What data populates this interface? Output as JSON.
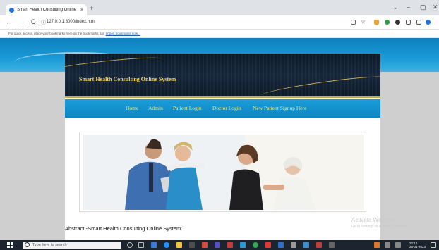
{
  "browser": {
    "tab_title": "Smart Health Consulting Online",
    "tab_close": "×",
    "new_tab": "+",
    "window_controls": [
      "⌄",
      "–",
      "▢",
      "✕"
    ],
    "back": "←",
    "forward": "→",
    "reload": "C",
    "url": "127.0.0.1:8000/index.html",
    "bookmarks_bar_text": "For quick access, place your bookmarks here on the bookmarks bar.",
    "bookmarks_bar_link": "Import bookmarks now..."
  },
  "site": {
    "title": "Smart Health Consulting Online System",
    "menu": [
      "Home",
      "Admin",
      "Patient Login",
      "Doctor Login",
      "New Patient Signup Here"
    ],
    "abstract": "Abstract:-Smart Health Consulting Online System."
  },
  "watermark": {
    "line1": "Activate Windows",
    "line2": "Go to Settings to activate Windows."
  },
  "taskbar": {
    "search_placeholder": "Type here to search",
    "time": "22:12",
    "date": "26-01-2023"
  },
  "colors": {
    "header_bg": "#0b1a2a",
    "title_gold": "#f3d35b",
    "menu_bg": "#1a9dd8",
    "menu_text": "#f7e56a"
  }
}
